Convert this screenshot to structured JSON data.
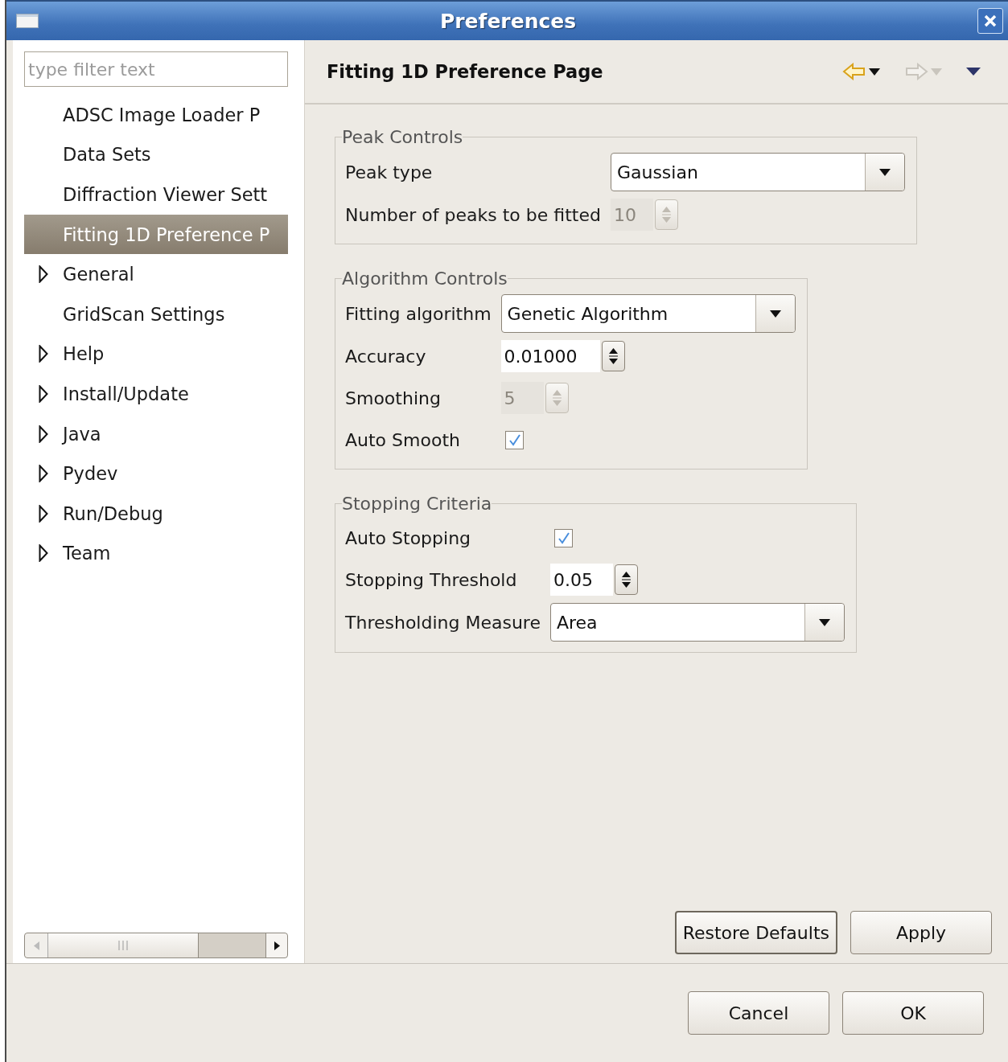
{
  "window": {
    "title": "Preferences"
  },
  "filter": {
    "placeholder": "type filter text"
  },
  "tree": [
    {
      "label": "ADSC Image Loader P",
      "expandable": false,
      "selected": false
    },
    {
      "label": "Data Sets",
      "expandable": false,
      "selected": false
    },
    {
      "label": "Diffraction Viewer Sett",
      "expandable": false,
      "selected": false
    },
    {
      "label": "Fitting 1D Preference P",
      "expandable": false,
      "selected": true
    },
    {
      "label": "General",
      "expandable": true,
      "selected": false
    },
    {
      "label": "GridScan Settings",
      "expandable": false,
      "selected": false
    },
    {
      "label": "Help",
      "expandable": true,
      "selected": false
    },
    {
      "label": "Install/Update",
      "expandable": true,
      "selected": false
    },
    {
      "label": "Java",
      "expandable": true,
      "selected": false
    },
    {
      "label": "Pydev",
      "expandable": true,
      "selected": false
    },
    {
      "label": "Run/Debug",
      "expandable": true,
      "selected": false
    },
    {
      "label": "Team",
      "expandable": true,
      "selected": false
    }
  ],
  "page": {
    "title": "Fitting 1D Preference Page",
    "nav": [
      {
        "kind": "back",
        "disabled": false
      },
      {
        "kind": "forward",
        "disabled": true
      },
      {
        "kind": "menu",
        "disabled": false
      }
    ]
  },
  "groups": [
    {
      "title": "Peak Controls",
      "rows": [
        {
          "kind": "combo",
          "label": "Peak type",
          "value": "Gaussian",
          "disabled": false
        },
        {
          "kind": "spinner",
          "label": "Number of peaks to be fitted",
          "value": "10",
          "disabled": true
        }
      ]
    },
    {
      "title": "Algorithm Controls",
      "rows": [
        {
          "kind": "combo",
          "label": "Fitting algorithm",
          "value": "Genetic Algorithm",
          "disabled": false
        },
        {
          "kind": "spinner",
          "label": "Accuracy",
          "value": "0.01000",
          "disabled": false
        },
        {
          "kind": "spinner",
          "label": "Smoothing",
          "value": "5",
          "disabled": true
        },
        {
          "kind": "checkbox",
          "label": "Auto Smooth",
          "checked": true,
          "disabled": false
        }
      ]
    },
    {
      "title": "Stopping Criteria",
      "rows": [
        {
          "kind": "checkbox",
          "label": "Auto Stopping",
          "checked": true,
          "disabled": false
        },
        {
          "kind": "spinner",
          "label": "Stopping Threshold",
          "value": "0.05",
          "disabled": false
        },
        {
          "kind": "combo",
          "label": "Thresholding Measure",
          "value": "Area",
          "disabled": false
        }
      ]
    }
  ],
  "page_buttons": [
    {
      "label": "Restore Defaults",
      "focused": true
    },
    {
      "label": "Apply",
      "focused": false
    }
  ],
  "dialog_buttons": [
    {
      "label": "Cancel",
      "focused": false
    },
    {
      "label": "OK",
      "focused": false
    }
  ]
}
